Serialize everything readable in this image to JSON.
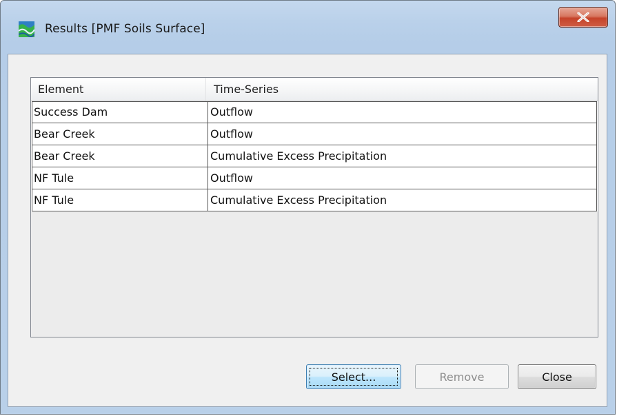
{
  "window": {
    "title": "Results [PMF Soils Surface]",
    "icon": "hms-basin-icon",
    "close_glyph": "X"
  },
  "table": {
    "columns": [
      "Element",
      "Time-Series"
    ],
    "rows": [
      {
        "element": "Success Dam",
        "time_series": "Outflow"
      },
      {
        "element": "Bear Creek",
        "time_series": "Outflow"
      },
      {
        "element": "Bear Creek",
        "time_series": "Cumulative Excess Precipitation"
      },
      {
        "element": "NF Tule",
        "time_series": "Outflow"
      },
      {
        "element": "NF Tule",
        "time_series": "Cumulative Excess Precipitation"
      }
    ]
  },
  "buttons": {
    "select_label": "Select...",
    "remove_label": "Remove",
    "close_label": "Close"
  },
  "colors": {
    "close_button": "#c7432b",
    "titlebar": "#bad1ea",
    "focus_button": "#a7d9f5"
  }
}
